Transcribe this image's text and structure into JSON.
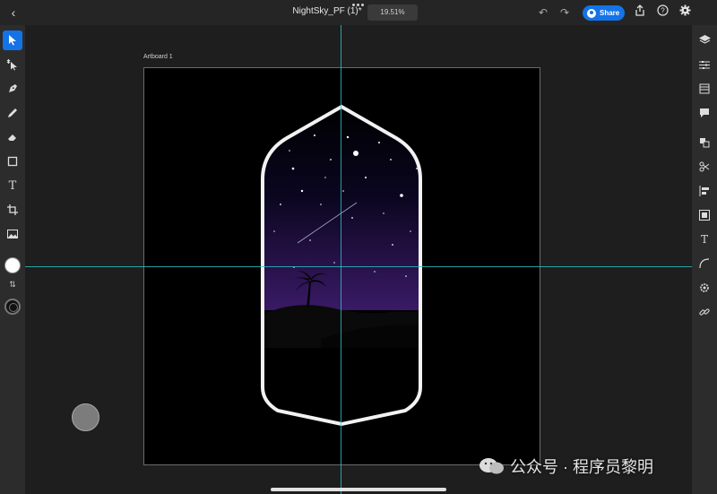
{
  "topbar": {
    "back_icon": "chevron-left-icon",
    "title": "NightSky_PF (1)*",
    "zoom": "19.51%",
    "share_label": "Share",
    "icons": [
      "undo-icon",
      "redo-icon",
      "export-icon",
      "help-icon",
      "gear-icon"
    ]
  },
  "left_toolbar": {
    "tools": [
      "select-tool",
      "direct-select-tool",
      "pen-tool",
      "pencil-tool",
      "eraser-tool",
      "shape-tool",
      "text-tool",
      "crop-tool",
      "image-tool"
    ],
    "active_tool": "select-tool",
    "fill_color": "#ffffff",
    "stroke_color": "#111111"
  },
  "right_toolbar": {
    "icons": [
      "layers-icon",
      "properties-icon",
      "libraries-icon",
      "comments-icon",
      "arrange-icon",
      "path-icon",
      "align-icon",
      "repeat-grid-icon",
      "text-icon",
      "curve-icon",
      "settings-icon",
      "link-icon"
    ]
  },
  "canvas": {
    "artboard_label": "Artboard 1",
    "artboard_color": "#000000",
    "guide_color": "#2ec4c7",
    "night_sky_top": "#000000",
    "night_sky_bottom": "#3a1a66",
    "badge_stroke": "#f2f2f2"
  },
  "watermark": {
    "text": "公众号 · 程序员黎明"
  }
}
